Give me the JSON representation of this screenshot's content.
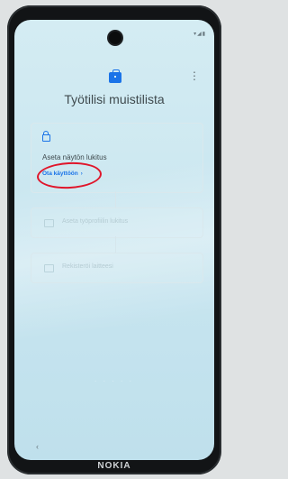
{
  "header": {
    "title": "Työtilisi muistilista",
    "work_icon": "briefcase-icon",
    "menu_icon": "more-vert-icon",
    "status_icons": "▾◢▮"
  },
  "checklist": {
    "step1": {
      "icon": "lock-icon",
      "title": "Aseta näytön lukitus",
      "action_label": "Ota käyttöön",
      "action_chevron": "›"
    },
    "step2": {
      "icon": "screen-lock-icon",
      "label": "Aseta työprofiilin lukitus"
    },
    "step3": {
      "icon": "data-icon",
      "label": "Rekisteröi laitteesi"
    }
  },
  "navigation": {
    "back_icon": "‹"
  },
  "device": {
    "brand": "NOKIA"
  },
  "colors": {
    "accent": "#1a73e8",
    "annotation_red": "#e0152a",
    "screen_bg": "#d4ecf3"
  }
}
